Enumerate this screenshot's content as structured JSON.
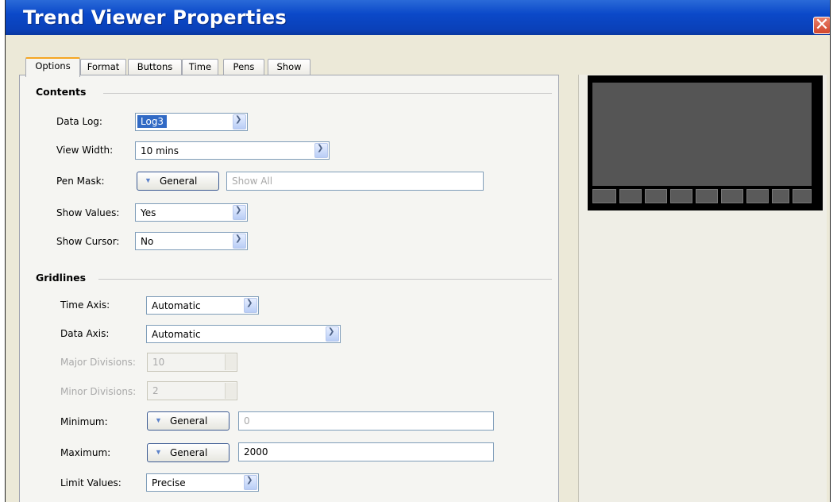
{
  "window": {
    "title": "Trend Viewer Properties",
    "close_glyph": "✕"
  },
  "tabs": [
    {
      "label": "Options",
      "active": true
    },
    {
      "label": "Format",
      "active": false
    },
    {
      "label": "Buttons",
      "active": false
    },
    {
      "label": "Time",
      "active": false
    },
    {
      "label": "Pens",
      "active": false
    },
    {
      "label": "Show",
      "active": false
    }
  ],
  "contents": {
    "section_title": "Contents",
    "data_log": {
      "label": "Data Log:",
      "value": "Log3"
    },
    "view_width": {
      "label": "View Width:",
      "value": "10 mins"
    },
    "pen_mask": {
      "label": "Pen Mask:",
      "button": "General",
      "placeholder": "Show All"
    },
    "show_values": {
      "label": "Show Values:",
      "value": "Yes"
    },
    "show_cursor": {
      "label": "Show Cursor:",
      "value": "No"
    }
  },
  "gridlines": {
    "section_title": "Gridlines",
    "time_axis": {
      "label": "Time Axis:",
      "value": "Automatic"
    },
    "data_axis": {
      "label": "Data Axis:",
      "value": "Automatic"
    },
    "major_divisions": {
      "label": "Major Divisions:",
      "value": "10"
    },
    "minor_divisions": {
      "label": "Minor Divisions:",
      "value": "2"
    },
    "minimum": {
      "label": "Minimum:",
      "button": "General",
      "value": "0"
    },
    "maximum": {
      "label": "Maximum:",
      "button": "General",
      "value": "2000"
    },
    "limit_values": {
      "label": "Limit Values:",
      "value": "Precise"
    }
  },
  "icons": {
    "dropdown": "chevron-down-icon",
    "general_button": "triangle-down-icon",
    "close": "close-icon"
  },
  "colors": {
    "title_bar": "#0b49c9",
    "close_button": "#d2462c",
    "selection": "#316ac5",
    "preview_bg": "#000000",
    "preview_plot": "#555555"
  }
}
